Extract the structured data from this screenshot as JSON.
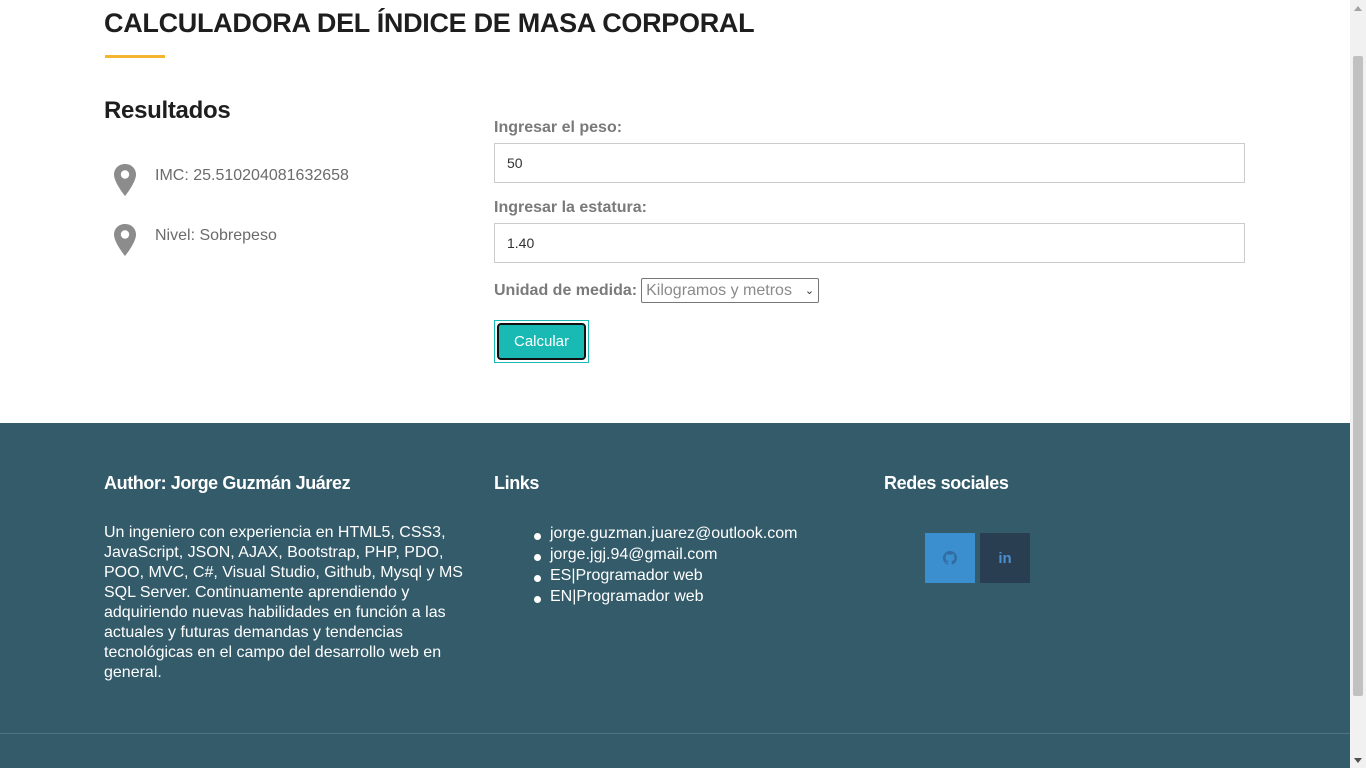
{
  "header": {
    "title": "CALCULADORA DEL ÍNDICE DE MASA CORPORAL",
    "accent_color": "#f5b52e"
  },
  "results": {
    "heading": "Resultados",
    "imc": "IMC: 25.510204081632658",
    "nivel": "Nivel: Sobrepeso",
    "icon": "map-marker-icon"
  },
  "form": {
    "peso_label": "Ingresar el peso:",
    "peso_value": "50",
    "estatura_label": "Ingresar la estatura:",
    "estatura_value": "1.40",
    "unidad_label": "Unidad de medida:",
    "unidad_selected": "Kilogramos y metros",
    "calcular_label": "Calcular",
    "button_color": "#19b9b4"
  },
  "footer": {
    "background": "#335b6a",
    "author_heading": "Author: Jorge Guzmán Juárez",
    "about": "Un ingeniero con experiencia en HTML5, CSS3, JavaScript, JSON, AJAX, Bootstrap, PHP, PDO, POO, MVC, C#, Visual Studio, Github, Mysql y MS SQL Server. Continuamente aprendiendo y adquiriendo nuevas habilidades en función a las actuales y futuras demandas y tendencias tecnológicas en el campo del desarrollo web en general.",
    "links_heading": "Links",
    "links": [
      "jorge.guzman.juarez@outlook.com",
      "jorge.jgj.94@gmail.com",
      "ES|Programador web",
      "EN|Programador web"
    ],
    "social_heading": "Redes sociales",
    "social": [
      {
        "icon": "github-icon",
        "color": "#3c8fcf"
      },
      {
        "icon": "linkedin-icon",
        "label": "in",
        "color": "#2a3e52"
      }
    ]
  }
}
